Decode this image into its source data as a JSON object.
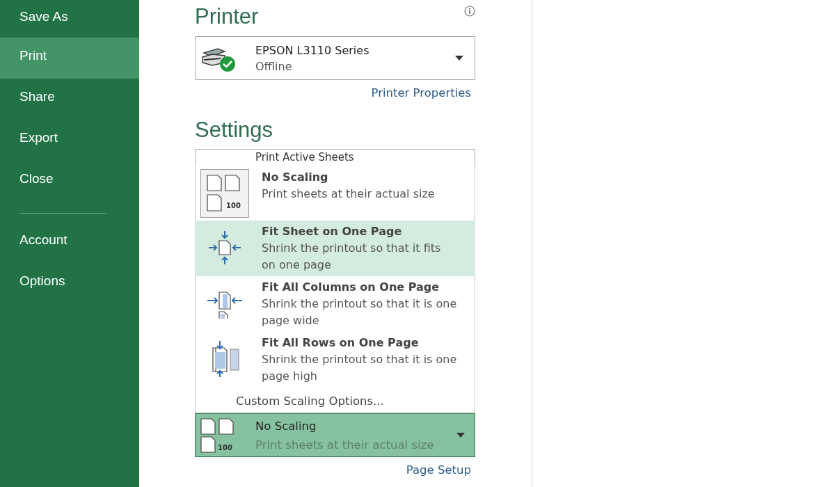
{
  "sidebar": {
    "items": [
      {
        "label": "Save As",
        "selected": false
      },
      {
        "label": "Print",
        "selected": true
      },
      {
        "label": "Share",
        "selected": false
      },
      {
        "label": "Export",
        "selected": false
      },
      {
        "label": "Close",
        "selected": false
      }
    ],
    "bottom_items": [
      {
        "label": "Account",
        "selected": false
      },
      {
        "label": "Options",
        "selected": false
      }
    ]
  },
  "printer": {
    "heading": "Printer",
    "name": "EPSON L3110 Series",
    "status": "Offline",
    "properties_link": "Printer Properties"
  },
  "settings": {
    "heading": "Settings",
    "covered_field": "Print Active Sheets",
    "scaling_menu": [
      {
        "kind": "no-scaling",
        "title": "No Scaling",
        "description": "Print sheets at their actual size",
        "icon_number": "100",
        "current": true,
        "hovered": false
      },
      {
        "kind": "fit-sheet",
        "title": "Fit Sheet on One Page",
        "description": "Shrink the printout so that it fits on one page",
        "current": false,
        "hovered": true
      },
      {
        "kind": "fit-columns",
        "title": "Fit All Columns on One Page",
        "description": "Shrink the printout so that it is one page wide",
        "current": false,
        "hovered": false
      },
      {
        "kind": "fit-rows",
        "title": "Fit All Rows on One Page",
        "description": "Shrink the printout so that it is one page high",
        "current": false,
        "hovered": false
      }
    ],
    "custom_option": "Custom Scaling Options...",
    "scaling_field": {
      "title": "No Scaling",
      "description": "Print sheets at their actual size",
      "icon_number": "100",
      "open": true
    },
    "page_setup_link": "Page Setup"
  }
}
